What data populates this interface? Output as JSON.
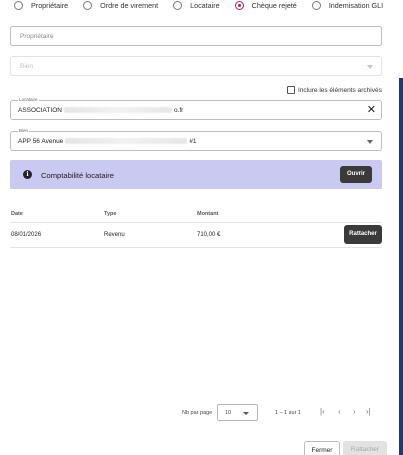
{
  "radio_group": {
    "options": [
      {
        "label": "Propriétaire",
        "checked": false
      },
      {
        "label": "Ordre de virement",
        "checked": false
      },
      {
        "label": "Locataire",
        "checked": false
      },
      {
        "label": "Chèque rejeté",
        "checked": true
      },
      {
        "label": "Indemisation GLI",
        "checked": false
      }
    ]
  },
  "proprietaire": {
    "placeholder": "Propriétaire"
  },
  "bien_disabled": {
    "placeholder": "Bien"
  },
  "archive_checkbox": {
    "label": "Inclure les éléments archivés",
    "checked": false
  },
  "locataire": {
    "label": "Locataire",
    "value_start": "ASSOCIATION",
    "value_end": "o.fr",
    "clear_icon": "close-icon"
  },
  "bien": {
    "label": "Bien",
    "value_start": "APP 56 Avenue",
    "value_end": "#1"
  },
  "banner": {
    "icon": "info-icon",
    "icon_glyph": "i",
    "title": "Comptabilité locataire",
    "button": "Ouvrir",
    "background": "#c9c9f1"
  },
  "table": {
    "headers": {
      "date": "Date",
      "type": "Type",
      "montant": "Montant"
    },
    "rows": [
      {
        "date": "08/01/2026",
        "type": "Revenu",
        "montant": "710,00 €",
        "action": "Rattacher"
      }
    ]
  },
  "pagination": {
    "per_page_label": "Nb par page",
    "per_page_value": "10",
    "range": "1 – 1 sur 1",
    "first_icon": "|‹",
    "prev_icon": "‹",
    "next_icon": "›",
    "last_icon": "›|"
  },
  "footer": {
    "close": "Fermer",
    "attach": "Rattacher"
  },
  "colors": {
    "accent": "#c2185b",
    "dark_button": "#3a3a3a",
    "side_strip": "#1f3a6b"
  }
}
